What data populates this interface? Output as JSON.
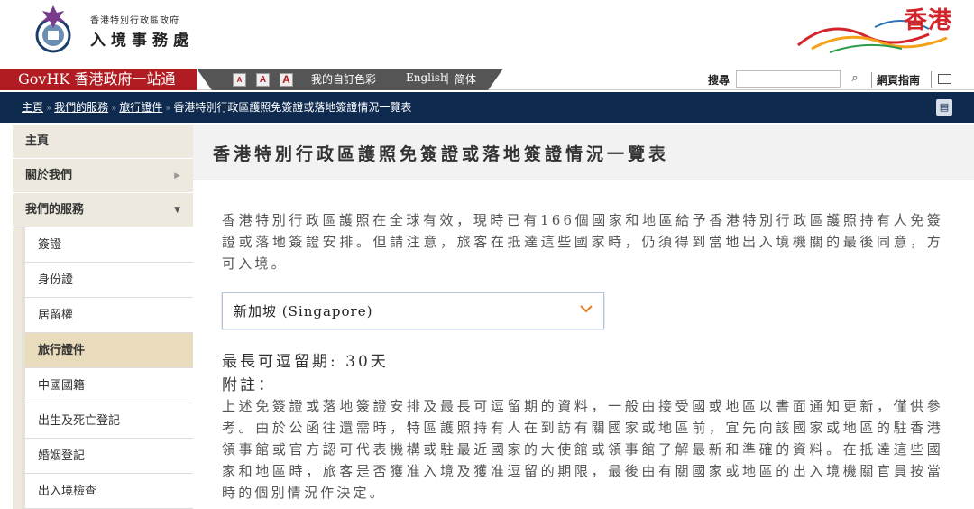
{
  "header": {
    "dept_small": "香港特別行政區政府",
    "dept_name": "入境事務處",
    "brand": "香港"
  },
  "govbar": {
    "govhk": "GovHK 香港政府一站通",
    "font_small": "A",
    "font_medium": "A",
    "font_large": "A",
    "custom_colour": "我的自訂色彩",
    "english": "English",
    "separator": "|",
    "simplified": "简体",
    "search_label": "搜尋",
    "search_placeholder": "",
    "site_guide": "網頁指南"
  },
  "breadcrumb": {
    "home": "主頁",
    "services": "我們的服務",
    "travel_docs": "旅行證件",
    "current": "香港特別行政區護照免簽證或落地簽證情況一覽表"
  },
  "sidebar": {
    "top": [
      {
        "label": "主頁"
      },
      {
        "label": "關於我們",
        "arrow": "▶"
      },
      {
        "label": "我們的服務",
        "arrow": "▼"
      }
    ],
    "sub": [
      {
        "label": "簽證"
      },
      {
        "label": "身份證"
      },
      {
        "label": "居留權"
      },
      {
        "label": "旅行證件",
        "active": true
      },
      {
        "label": "中國國籍"
      },
      {
        "label": "出生及死亡登記"
      },
      {
        "label": "婚姻登記"
      },
      {
        "label": "出入境檢查"
      }
    ]
  },
  "main": {
    "title": "香港特別行政區護照免簽證或落地簽證情況一覽表",
    "intro": "香港特別行政區護照在全球有效，現時已有166個國家和地區給予香港特別行政區護照持有人免簽證或落地簽證安排。但請注意，旅客在抵達這些國家時，仍須得到當地出入境機關的最後同意，方可入境。",
    "selected_country": "新加坡 (Singapore)",
    "max_stay": "最長可逗留期: 30天",
    "note_heading": "附註：",
    "note_text": "上述免簽證或落地簽證安排及最長可逗留期的資料，一般由接受國或地區以書面通知更新，僅供參考。由於公函往還需時，特區護照持有人在到訪有關國家或地區前，宜先向該國家或地區的駐香港領事館或官方認可代表機構或駐最近國家的大使館或領事館了解最新和準確的資料。在抵達這些國家和地區時，旅客是否獲准入境及獲准逗留的期限，最後由有關國家或地區的出入境機關官員按當時的個別情況作決定。"
  },
  "colors": {
    "govhk_red": "#b01c21",
    "nav_navy": "#0e2a4f",
    "sidebar_beige": "#ede9df",
    "active_item": "#e8dcbd",
    "chevron_orange": "#e8832a"
  }
}
